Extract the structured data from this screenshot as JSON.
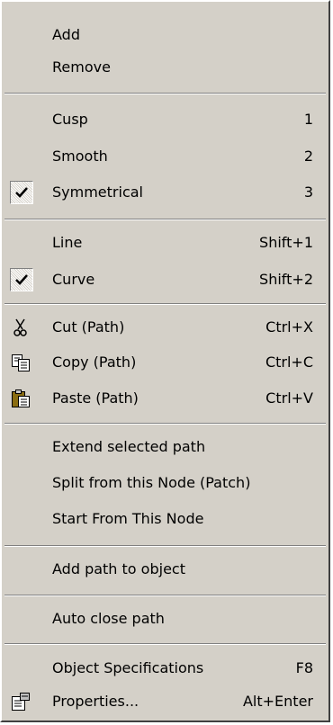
{
  "menu": {
    "add": "Add",
    "remove": "Remove",
    "cusp": {
      "label": "Cusp",
      "shortcut": "1"
    },
    "smooth": {
      "label": "Smooth",
      "shortcut": "2"
    },
    "symmetrical": {
      "label": "Symmetrical",
      "shortcut": "3",
      "checked": true
    },
    "line": {
      "label": "Line",
      "shortcut": "Shift+1"
    },
    "curve": {
      "label": "Curve",
      "shortcut": "Shift+2",
      "checked": true
    },
    "cut": {
      "label": "Cut (Path)",
      "shortcut": "Ctrl+X",
      "icon": "scissors-icon"
    },
    "copy": {
      "label": "Copy (Path)",
      "shortcut": "Ctrl+C",
      "icon": "copy-icon"
    },
    "paste": {
      "label": "Paste (Path)",
      "shortcut": "Ctrl+V",
      "icon": "paste-icon"
    },
    "extend": "Extend selected path",
    "split": "Split from this Node (Patch)",
    "start": "Start From This Node",
    "add_path": "Add path to object",
    "auto_close": "Auto close path",
    "object_specs": {
      "label": "Object Specifications",
      "shortcut": "F8"
    },
    "properties": {
      "label": "Properties...",
      "shortcut": "Alt+Enter",
      "icon": "properties-icon"
    }
  },
  "colors": {
    "menu_bg": "#d4d0c8",
    "highlight": "#ffffff",
    "shadow": "#808080"
  }
}
